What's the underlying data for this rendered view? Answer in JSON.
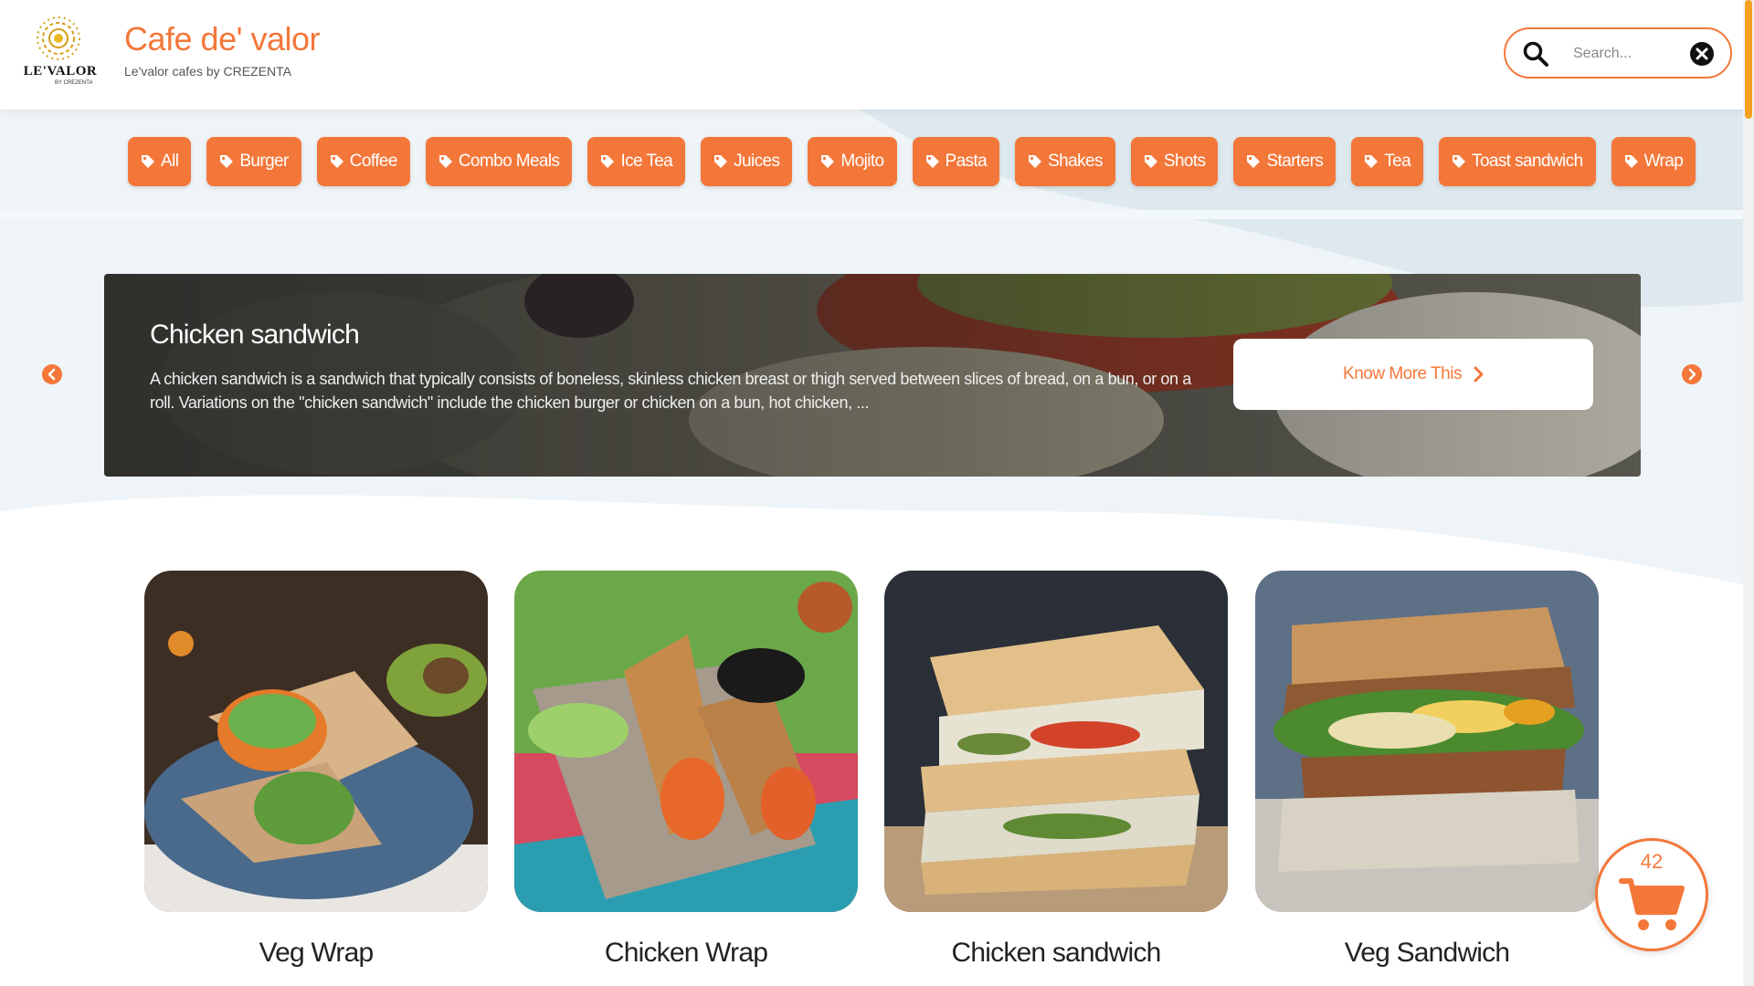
{
  "brand": {
    "logo_text": "LE'VALOR",
    "logo_sub": "BY CREZENTA",
    "title": "Cafe de' valor",
    "subtitle": "Le'valor cafes by CREZENTA"
  },
  "search": {
    "placeholder": "Search..."
  },
  "categories": [
    "All",
    "Burger",
    "Coffee",
    "Combo Meals",
    "Ice Tea",
    "Juices",
    "Mojito",
    "Pasta",
    "Shakes",
    "Shots",
    "Starters",
    "Tea",
    "Toast sandwich",
    "Wrap"
  ],
  "banner": {
    "title": "Chicken sandwich",
    "description": "A chicken sandwich is a sandwich that typically consists of boneless, skinless chicken breast or thigh served between slices of bread, on a bun, or on a roll. Variations on the \"chicken sandwich\" include the chicken burger or chicken on a bun, hot chicken, ...",
    "button_label": "Know More This"
  },
  "products": [
    {
      "name": "Veg Wrap"
    },
    {
      "name": "Chicken Wrap"
    },
    {
      "name": "Chicken sandwich"
    },
    {
      "name": "Veg Sandwich"
    }
  ],
  "cart": {
    "count": "42"
  },
  "colors": {
    "accent": "#f4773a",
    "background": "#eef4f7",
    "scroll_thumb": "#f4a020"
  },
  "icons": {
    "search": "search-icon",
    "clear": "close-circle-icon",
    "tag": "tag-icon",
    "prev": "chevron-left-circle-icon",
    "next": "chevron-right-circle-icon",
    "cart": "shopping-cart-icon"
  }
}
